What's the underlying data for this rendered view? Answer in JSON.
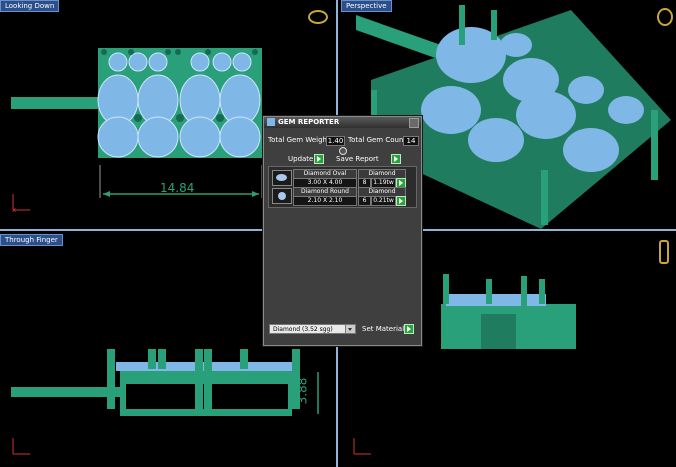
{
  "viewports": {
    "top_left": {
      "label": "Looking Down",
      "dimension": "14.84"
    },
    "top_right": {
      "label": "Perspective"
    },
    "bottom_left": {
      "label": "Through Finger",
      "dimension": "3.88"
    },
    "bottom_right": {
      "label": ""
    }
  },
  "gem_reporter": {
    "title": "GEM REPORTER",
    "total_weight_label": "Total Gem Weight",
    "total_weight_value": "1.40",
    "total_count_label": "Total Gem Count",
    "total_count_value": "14",
    "update_label": "Update",
    "save_label": "Save Report",
    "gems": [
      {
        "shape": "Diamond Oval",
        "size": "3.00 X 4.00",
        "material": "Diamond",
        "count": "8",
        "weight": "1.19tw"
      },
      {
        "shape": "Diamond Round",
        "size": "2.10 X 2.10",
        "material": "Diamond",
        "count": "6",
        "weight": "0.21tw"
      }
    ],
    "material_select": "Diamond     (3.52 sgg)",
    "set_material_label": "Set Material"
  },
  "colors": {
    "metal": "#2aa07a",
    "gem": "#7fb7e6",
    "panel": "#3f3f3f",
    "accent_green": "#29a33a"
  }
}
